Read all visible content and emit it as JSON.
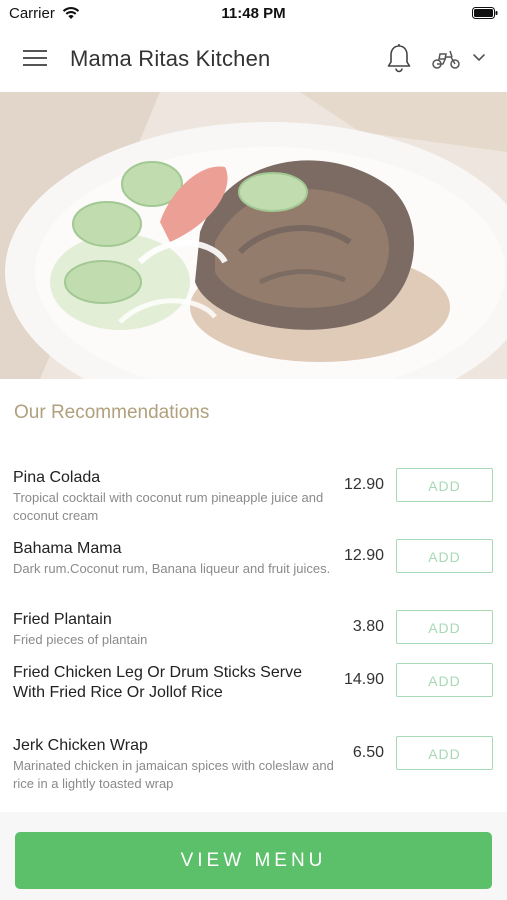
{
  "status_bar": {
    "carrier": "Carrier",
    "time": "11:48 PM"
  },
  "header": {
    "title": "Mama Ritas Kitchen",
    "icons": [
      "menu-icon",
      "bell-icon",
      "scooter-icon",
      "chevron-down-icon"
    ]
  },
  "hero": {
    "image": "grilled-jerk-chicken-plate"
  },
  "recommendations": {
    "title": "Our Recommendations",
    "add_label": "ADD",
    "items": [
      {
        "name": "Pina Colada",
        "description": "Tropical cocktail with coconut rum pineapple juice and coconut cream",
        "price": "12.90"
      },
      {
        "name": "Bahama Mama",
        "description": "Dark rum.Coconut rum, Banana liqueur and fruit juices.",
        "price": "12.90"
      },
      {
        "name": "Fried Plantain",
        "description": "Fried pieces of plantain",
        "price": "3.80"
      },
      {
        "name": "Fried Chicken Leg Or Drum Sticks Serve With Fried Rice Or Jollof Rice",
        "description": "",
        "price": "14.90"
      },
      {
        "name": "Jerk Chicken Wrap",
        "description": "Marinated chicken in jamaican spices with coleslaw and rice  in a lightly toasted wrap",
        "price": "6.50"
      }
    ]
  },
  "footer": {
    "view_menu_label": "VIEW MENU"
  },
  "colors": {
    "accent_green": "#5cbf6a",
    "add_border": "#a8d9b4",
    "section_title": "#b0a07e"
  }
}
